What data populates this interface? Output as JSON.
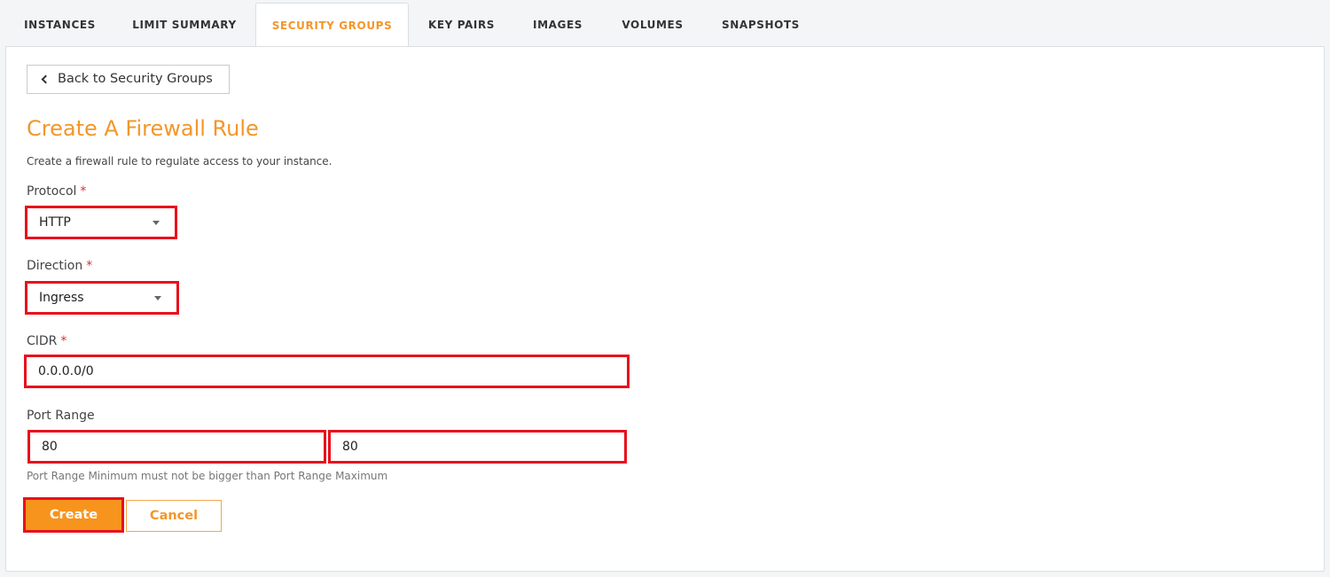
{
  "tabs": [
    {
      "label": "INSTANCES"
    },
    {
      "label": "LIMIT SUMMARY"
    },
    {
      "label": "SECURITY GROUPS",
      "active": true
    },
    {
      "label": "KEY PAIRS"
    },
    {
      "label": "IMAGES"
    },
    {
      "label": "VOLUMES"
    },
    {
      "label": "SNAPSHOTS"
    }
  ],
  "back_button": {
    "label": "Back to Security Groups",
    "icon": "chevron-left-icon"
  },
  "form": {
    "title": "Create A Firewall Rule",
    "description": "Create a firewall rule to regulate access to your instance.",
    "required_marker": "*",
    "protocol": {
      "label": "Protocol",
      "value": "HTTP"
    },
    "direction": {
      "label": "Direction",
      "value": "Ingress"
    },
    "cidr": {
      "label": "CIDR",
      "value": "0.0.0.0/0"
    },
    "port_range": {
      "label": "Port Range",
      "min": "80",
      "max": "80",
      "hint": "Port Range Minimum must not be bigger than Port Range Maximum"
    },
    "create_label": "Create",
    "cancel_label": "Cancel"
  },
  "colors": {
    "accent": "#f3962a",
    "highlight_border": "#e8101c",
    "required": "#d9302c"
  }
}
